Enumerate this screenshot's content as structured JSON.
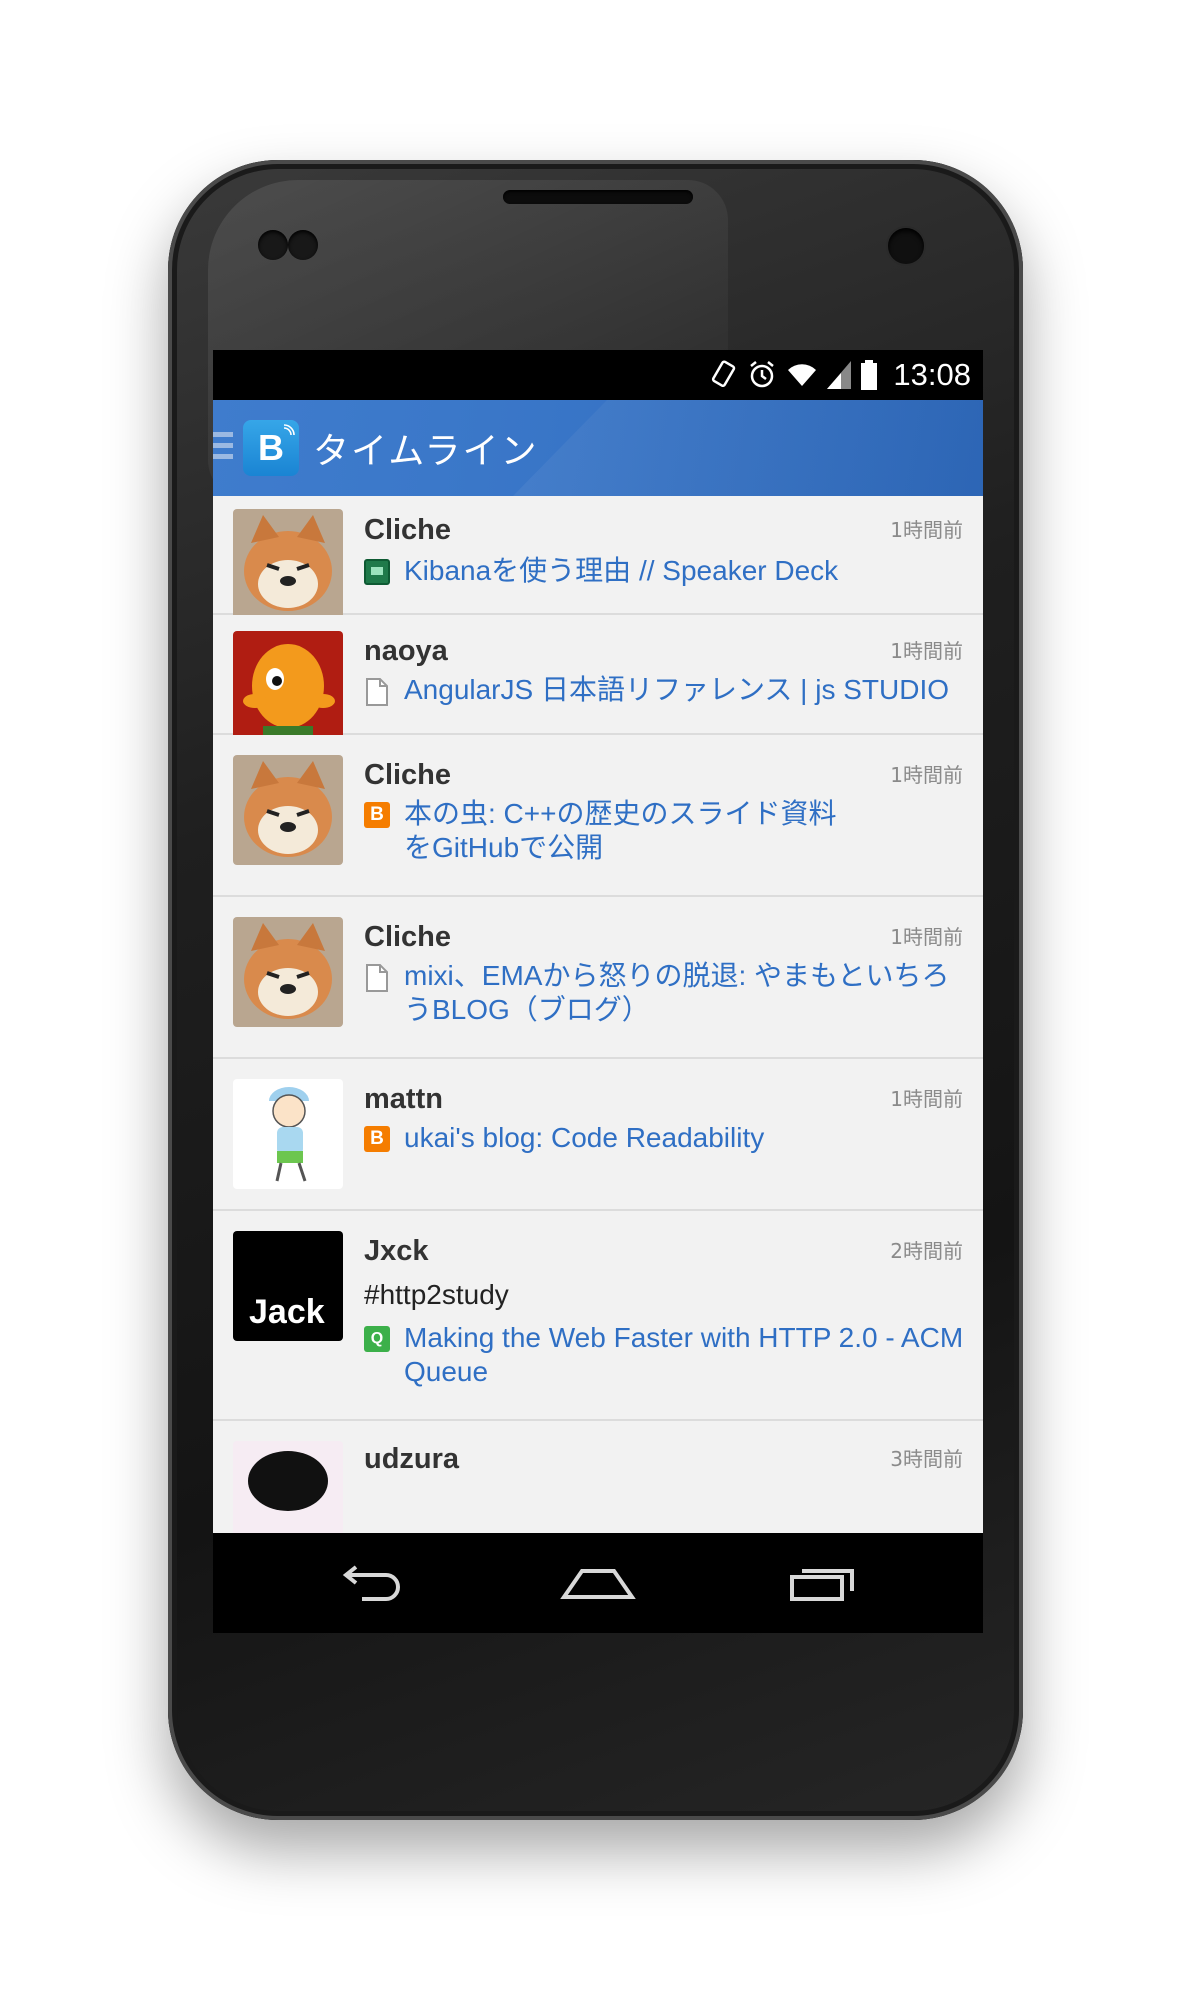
{
  "status_bar": {
    "time": "13:08",
    "icons": [
      "rotate-icon",
      "alarm-icon",
      "wifi-icon",
      "signal-icon",
      "battery-icon"
    ]
  },
  "action_bar": {
    "title": "タイムライン",
    "logo_letter": "B",
    "color": "#3b78c9"
  },
  "timeline": [
    {
      "user": "Cliche",
      "time_ago": "1時間前",
      "comment": "",
      "favicon": "speakerdeck-icon",
      "link": "Kibanaを使う理由 // Speaker Deck",
      "avatar": "shiba-dog-avatar"
    },
    {
      "user": "naoya",
      "time_ago": "1時間前",
      "comment": "",
      "favicon": "page-icon",
      "link": "AngularJS 日本語リファレンス | js STUDIO",
      "avatar": "orange-figure-avatar"
    },
    {
      "user": "Cliche",
      "time_ago": "1時間前",
      "comment": "",
      "favicon": "blogger-icon",
      "link": "本の虫: C++の歴史のスライド資料をGitHubで公開",
      "avatar": "shiba-dog-avatar"
    },
    {
      "user": "Cliche",
      "time_ago": "1時間前",
      "comment": "",
      "favicon": "page-icon",
      "link": "mixi、EMAから怒りの脱退: やまもといちろうBLOG（ブログ）",
      "avatar": "shiba-dog-avatar"
    },
    {
      "user": "mattn",
      "time_ago": "1時間前",
      "comment": "",
      "favicon": "blogger-icon",
      "link": "ukai's blog: Code Readability",
      "avatar": "cartoon-boy-avatar"
    },
    {
      "user": "Jxck",
      "time_ago": "2時間前",
      "comment": "#http2study",
      "favicon": "queue-icon",
      "link": "Making the Web Faster with HTTP 2.0 - ACM Queue",
      "avatar": "jack-text-avatar",
      "avatar_text": "Jack"
    },
    {
      "user": "udzura",
      "time_ago": "3時間前",
      "comment": "",
      "favicon": "",
      "link": "",
      "avatar": "dark-hair-avatar"
    }
  ],
  "nav": [
    "back-icon",
    "home-icon",
    "recents-icon"
  ],
  "colors": {
    "link": "#2f6fc4",
    "username": "#333333",
    "list_bg": "#f2f2f2"
  }
}
